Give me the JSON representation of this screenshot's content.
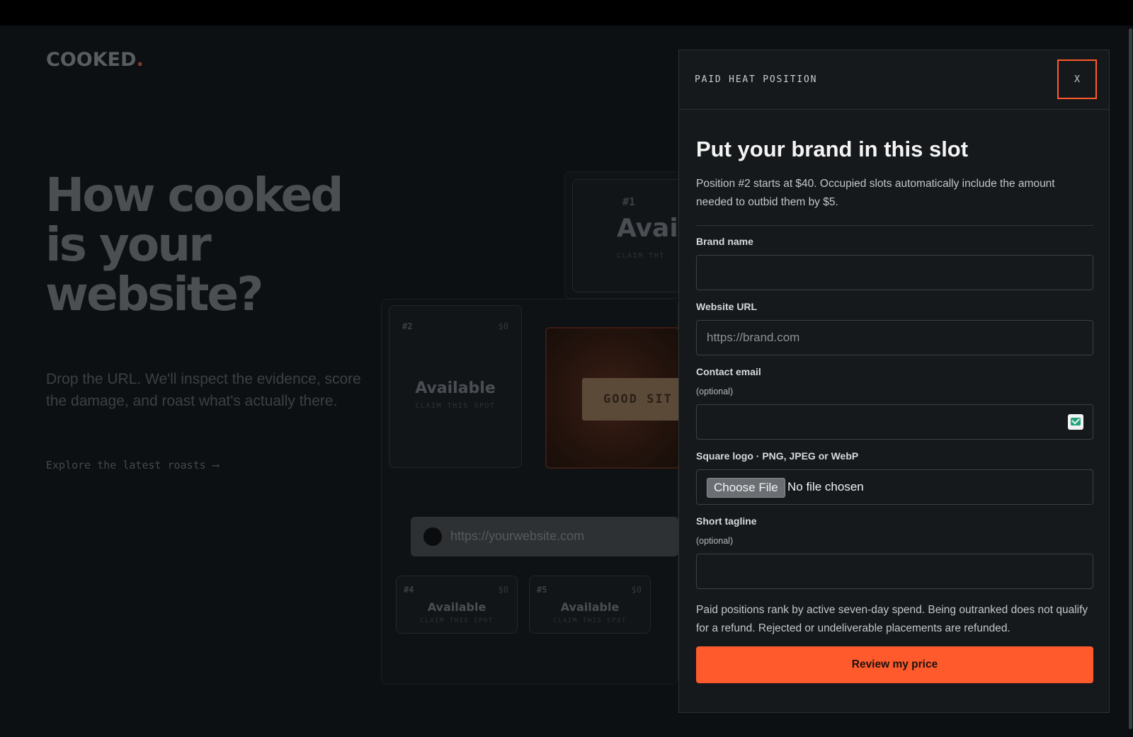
{
  "background": {
    "logo": {
      "text": "COOKED",
      "dot": "."
    },
    "headline": "How cooked is your website?",
    "subtext": "Drop the URL. We'll inspect the evidence, score the damage, and roast what's actually there.",
    "explore_link": "Explore the latest roasts ⟶",
    "slots": [
      {
        "num": "#1",
        "avail": "Avai",
        "claim": "CLAIM THI"
      },
      {
        "num": "#2",
        "price": "$0",
        "avail": "Available",
        "claim": "CLAIM THIS SPOT"
      },
      {
        "num": "#4",
        "price": "$0",
        "avail": "Available",
        "claim": "CLAIM THIS SPOT"
      },
      {
        "num": "#5",
        "price": "$0",
        "avail": "Available",
        "claim": "CLAIM THIS SPOT"
      }
    ],
    "featured_tag": "GOOD SIT",
    "url_placeholder": "https://yourwebsite.com"
  },
  "modal": {
    "eyebrow": "PAID HEAT POSITION",
    "close_label": "X",
    "title": "Put your brand in this slot",
    "description": "Position #2 starts at $40. Occupied slots automatically include the amount needed to outbid them by $5.",
    "fields": {
      "brand_name": {
        "label": "Brand name",
        "value": "",
        "placeholder": ""
      },
      "website_url": {
        "label": "Website URL",
        "value": "",
        "placeholder": "https://brand.com"
      },
      "contact_email": {
        "label": "Contact email",
        "hint": "(optional)",
        "value": "",
        "placeholder": ""
      },
      "logo": {
        "label": "Square logo · PNG, JPEG or WebP",
        "button": "Choose File",
        "status": "No file chosen"
      },
      "tagline": {
        "label": "Short tagline",
        "hint": "(optional)",
        "value": "",
        "placeholder": ""
      }
    },
    "policy": "Paid positions rank by active seven-day spend. Being outranked does not qualify for a refund. Rejected or undeliverable placements are refunded.",
    "cta_label": "Review my price"
  },
  "colors": {
    "accent": "#ff5a2c",
    "modal_bg": "#16191c",
    "page_bg": "#0d1012"
  }
}
